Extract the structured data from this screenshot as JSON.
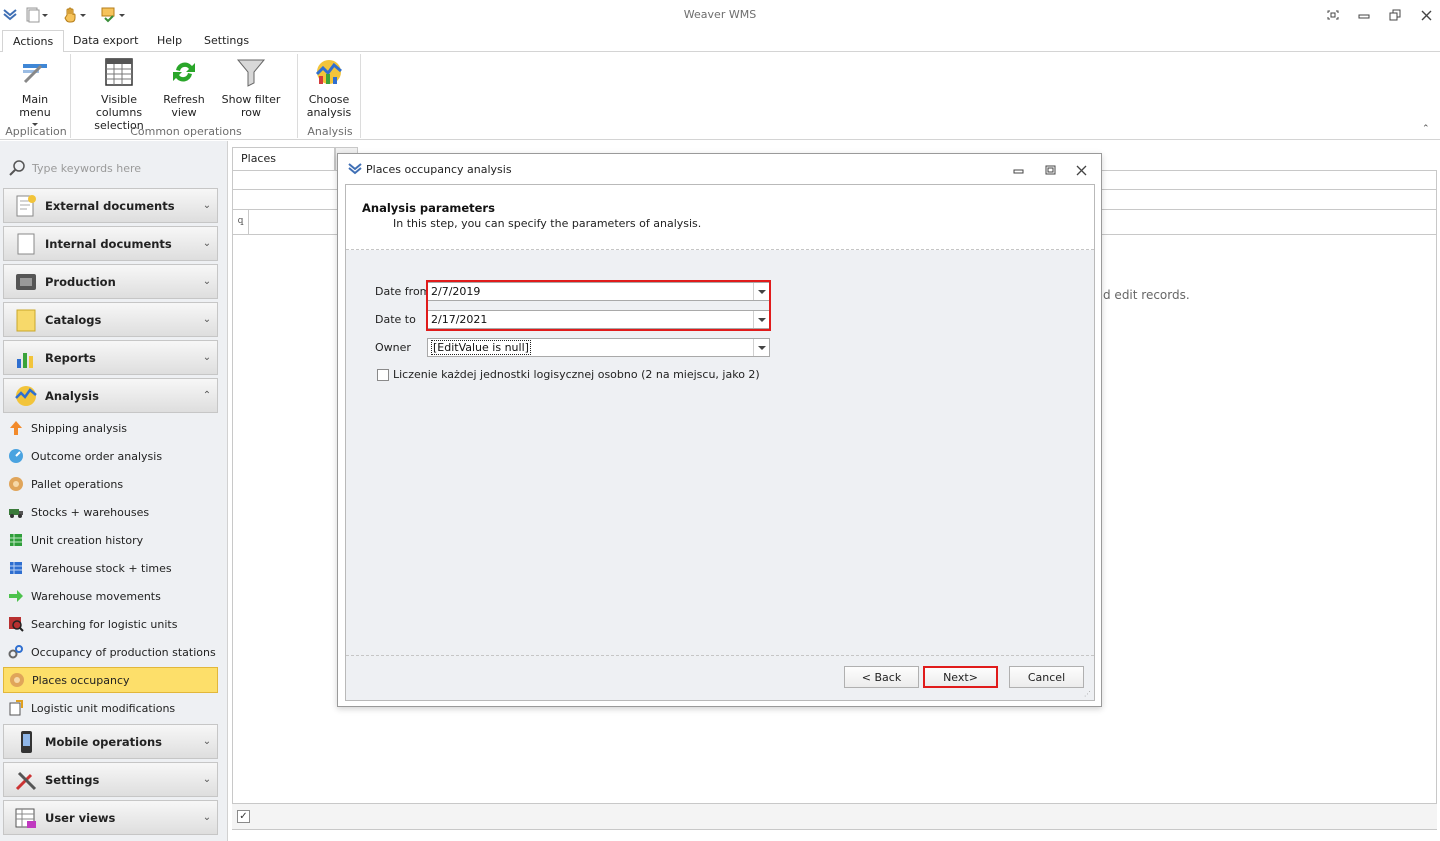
{
  "app": {
    "title": "Weaver WMS"
  },
  "ribbon": {
    "tabs": [
      "Actions",
      "Data export",
      "Help",
      "Settings"
    ],
    "buttons": {
      "main_menu": "Main menu",
      "visible_columns": [
        "Visible columns",
        "selection"
      ],
      "refresh": [
        "Refresh",
        "view"
      ],
      "show_filter": "Show filter row",
      "choose_analysis": [
        "Choose",
        "analysis"
      ]
    },
    "groups": {
      "application": "Application",
      "common": "Common operations",
      "analysis": "Analysis"
    }
  },
  "nav": {
    "search_placeholder": "Type keywords here",
    "groups": {
      "external": "External documents",
      "internal": "Internal documents",
      "production": "Production",
      "catalogs": "Catalogs",
      "reports": "Reports",
      "analysis": "Analysis",
      "mobile": "Mobile operations",
      "settings": "Settings",
      "userviews": "User views"
    },
    "analysis_items": [
      "Shipping analysis",
      "Outcome order analysis",
      "Pallet operations",
      "Stocks + warehouses",
      "Unit creation history",
      "Warehouse stock + times",
      "Warehouse movements",
      "Searching for logistic units",
      "Occupancy of production stations",
      "Places occupancy",
      "Logistic unit modifications"
    ]
  },
  "workspace": {
    "doc_tab": "Places occupancy",
    "empty_hint": "d  edit records."
  },
  "dialog": {
    "title": "Places occupancy analysis",
    "header_title": "Analysis parameters",
    "header_sub": "In this step, you can specify the parameters of analysis.",
    "date_from_label": "Date from",
    "date_from_value": "2/7/2019",
    "date_to_label": "Date to",
    "date_to_value": "2/17/2021",
    "owner_label": "Owner",
    "owner_value": "[EditValue is null]",
    "checkbox_label": "Liczenie każdej jednostki logisycznej osobno (2 na miejscu, jako 2)",
    "buttons": {
      "back": "< Back",
      "next": "Next>",
      "cancel": "Cancel"
    }
  },
  "colors": {
    "highlight_red": "#e01b1b",
    "selected_nav": "#fddf6a",
    "nav_bg": "#eef0f3"
  }
}
